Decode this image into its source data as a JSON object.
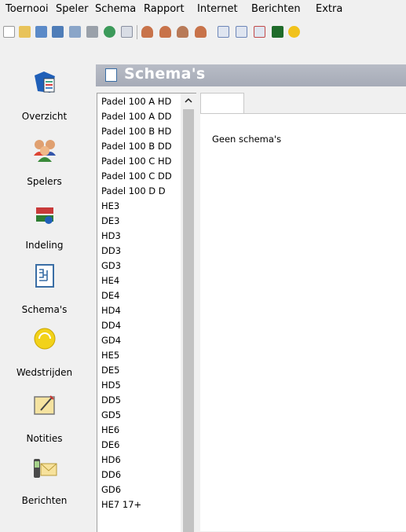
{
  "menu": [
    "Toernooi",
    "Speler",
    "Schema",
    "Rapport",
    "Internet",
    "Berichten",
    "Extra"
  ],
  "toolbar_icons": [
    "new-icon",
    "open-icon",
    "save-icon",
    "save-as-icon",
    "print-setup-icon",
    "print-icon",
    "web-icon",
    "mail-icon",
    "player-icon",
    "player-add-icon",
    "player-link-icon",
    "player-remove-icon",
    "schedule-icon",
    "schedule-add-icon",
    "schedule-edit-icon",
    "score-icon",
    "sun-icon"
  ],
  "nav": [
    {
      "label": "Overzicht",
      "icon": "overview-icon"
    },
    {
      "label": "Spelers",
      "icon": "players-icon"
    },
    {
      "label": "Indeling",
      "icon": "division-icon"
    },
    {
      "label": "Schema's",
      "icon": "draws-icon"
    },
    {
      "label": "Wedstrijden",
      "icon": "matches-icon"
    },
    {
      "label": "Notities",
      "icon": "notes-icon"
    },
    {
      "label": "Berichten",
      "icon": "messages-icon"
    }
  ],
  "title": "Schema's",
  "draws": [
    "Padel 100 A HD",
    "Padel 100 A DD",
    "Padel 100 B HD",
    "Padel 100 B DD",
    "Padel 100 C HD",
    "Padel 100 C DD",
    "Padel 100 D D",
    "HE3",
    "DE3",
    "HD3",
    "DD3",
    "GD3",
    "HE4",
    "DE4",
    "HD4",
    "DD4",
    "GD4",
    "HE5",
    "DE5",
    "HD5",
    "DD5",
    "GD5",
    "HE6",
    "DE6",
    "HD6",
    "DD6",
    "GD6",
    "HE7 17+"
  ],
  "empty_message": "Geen schema's",
  "colors": {
    "title_bar": "#a9aeba",
    "selection": "#f0f0f0"
  }
}
